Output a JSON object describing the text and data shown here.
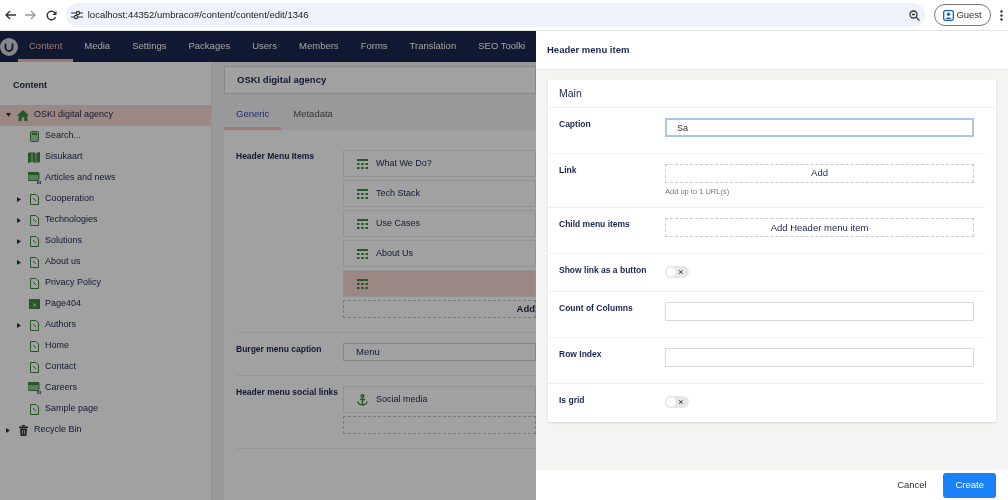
{
  "browser": {
    "url": "localhost:44352/umbraco#/content/content/edit/1346",
    "profile": "Guest"
  },
  "nav": [
    {
      "label": "Content",
      "selected": true
    },
    {
      "label": "Media",
      "selected": false
    },
    {
      "label": "Settings",
      "selected": false
    },
    {
      "label": "Packages",
      "selected": false
    },
    {
      "label": "Users",
      "selected": false
    },
    {
      "label": "Members",
      "selected": false
    },
    {
      "label": "Forms",
      "selected": false
    },
    {
      "label": "Translation",
      "selected": false
    },
    {
      "label": "SEO Toolki",
      "selected": false
    }
  ],
  "sidebar": {
    "title": "Content",
    "tree": [
      {
        "label": "OSKI digital agency",
        "kind": "home",
        "expanded": true,
        "selected": true,
        "children": [
          {
            "label": "Search...",
            "kind": "search",
            "selected": false
          },
          {
            "label": "Sisukaart",
            "kind": "map",
            "selected": false
          },
          {
            "label": "Articles and news",
            "kind": "list",
            "selected": false
          },
          {
            "label": "Cooperation",
            "kind": "page",
            "expanded": false,
            "selected": false
          },
          {
            "label": "Technologies",
            "kind": "page",
            "expanded": false,
            "selected": false
          },
          {
            "label": "Solutions",
            "kind": "page",
            "expanded": false,
            "selected": false
          },
          {
            "label": "About us",
            "kind": "page",
            "expanded": false,
            "selected": false
          },
          {
            "label": "Privacy Policy",
            "kind": "page",
            "selected": false
          },
          {
            "label": "Page404",
            "kind": "error",
            "selected": false
          },
          {
            "label": "Authors",
            "kind": "page",
            "expanded": false,
            "selected": false
          },
          {
            "label": "Home",
            "kind": "page",
            "selected": false
          },
          {
            "label": "Contact",
            "kind": "page",
            "selected": false
          },
          {
            "label": "Careers",
            "kind": "list",
            "selected": false
          },
          {
            "label": "Sample page",
            "kind": "page",
            "selected": false
          }
        ]
      },
      {
        "label": "Recycle Bin",
        "kind": "trash",
        "expanded": false,
        "selected": false
      }
    ]
  },
  "document": {
    "name": "OSKI digital agency",
    "tabs": [
      {
        "label": "Generic",
        "selected": true
      },
      {
        "label": "Metadata",
        "selected": false
      }
    ],
    "properties": [
      {
        "label": "Header Menu Items",
        "kind": "blocks",
        "blocks": [
          {
            "label": "What We Do?",
            "kind": "grid",
            "selected": false
          },
          {
            "label": "Tech Stack",
            "kind": "grid",
            "selected": false
          },
          {
            "label": "Use Cases",
            "kind": "grid",
            "selected": false
          },
          {
            "label": "About Us",
            "kind": "grid",
            "selected": false
          },
          {
            "kind": "grid",
            "selected": true
          }
        ],
        "add": "Add"
      },
      {
        "label": "Burger menu caption",
        "kind": "text",
        "value": "Menu"
      },
      {
        "label": "Header menu social links",
        "kind": "blocks",
        "blocks": [
          {
            "label": "Social media",
            "kind": "anchor",
            "selected": false
          }
        ]
      }
    ]
  },
  "panel": {
    "title": "Header menu item",
    "group": "Main",
    "fields": [
      {
        "label": "Caption",
        "kind": "text",
        "value": "Sa",
        "focused": true
      },
      {
        "label": "Link",
        "kind": "add",
        "button": "Add",
        "hint": "Add up to 1 URL(s)"
      },
      {
        "label": "Child menu items",
        "kind": "add",
        "button": "Add Header menu item"
      },
      {
        "label": "Show link as a button",
        "kind": "toggle",
        "on": false
      },
      {
        "label": "Count of Columns",
        "kind": "text",
        "focused": false
      },
      {
        "label": "Row Index",
        "kind": "text",
        "focused": false
      },
      {
        "label": "Is grid",
        "kind": "toggle",
        "on": false
      }
    ],
    "buttons": [
      {
        "label": "Cancel",
        "kind": "link"
      },
      {
        "label": "Create",
        "kind": "primary"
      }
    ]
  }
}
